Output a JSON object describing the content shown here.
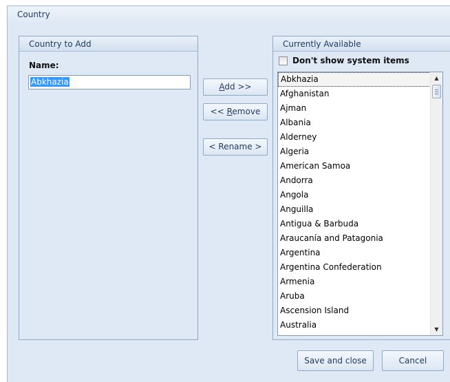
{
  "window": {
    "title": "Country"
  },
  "left_panel": {
    "header": "Country to Add",
    "name_label": "Name:",
    "name_value": "Abkhazia"
  },
  "buttons": {
    "add": "Add >>",
    "remove": "<< Remove",
    "rename": "< Rename >",
    "save_and_close": "Save and close",
    "cancel": "Cancel"
  },
  "right_panel": {
    "header": "Currently Available",
    "checkbox_label": "Don't show system items",
    "checkbox_checked": false,
    "selected_item": "Abkhazia",
    "items": [
      "Abkhazia",
      "Afghanistan",
      "Ajman",
      "Albania",
      "Alderney",
      "Algeria",
      "American Samoa",
      "Andorra",
      "Angola",
      "Anguilla",
      "Antigua & Barbuda",
      "Araucanía and Patagonia",
      "Argentina",
      "Argentina Confederation",
      "Armenia",
      "Aruba",
      "Ascension Island",
      "Australia"
    ]
  },
  "icons": {
    "scroll_up": "scroll-up-arrow-icon",
    "scroll_down": "scroll-down-arrow-icon",
    "checkbox": "checkbox-icon"
  }
}
